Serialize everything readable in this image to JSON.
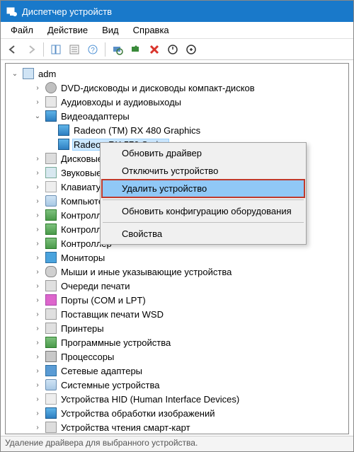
{
  "title": "Диспетчер устройств",
  "menu": {
    "file": "Файл",
    "action": "Действие",
    "view": "Вид",
    "help": "Справка"
  },
  "tree": {
    "root": "adm",
    "items": [
      {
        "label": "DVD-дисководы и дисководы компакт-дисков",
        "indent": 2,
        "icon": "icn-disc",
        "exp": ">"
      },
      {
        "label": "Аудиовходы и аудиовыходы",
        "indent": 2,
        "icon": "icn-audio",
        "exp": ">"
      },
      {
        "label": "Видеоадаптеры",
        "indent": 2,
        "icon": "icn-vid",
        "exp": "v"
      },
      {
        "label": "Radeon (TM) RX 480 Graphics",
        "indent": 3,
        "icon": "icn-vid",
        "exp": ""
      },
      {
        "label": "Radeon RX 570 Series",
        "indent": 3,
        "icon": "icn-vid",
        "exp": "",
        "sel": true
      },
      {
        "label": "Дисковые у",
        "indent": 2,
        "icon": "icn-drv",
        "exp": ">"
      },
      {
        "label": "Звуковые, в",
        "indent": 2,
        "icon": "icn-snd",
        "exp": ">"
      },
      {
        "label": "Клавиатуры",
        "indent": 2,
        "icon": "icn-kb",
        "exp": ">"
      },
      {
        "label": "Компьютер",
        "indent": 2,
        "icon": "icn-pc",
        "exp": ">"
      },
      {
        "label": "Контроллер",
        "indent": 2,
        "icon": "icn-ctr",
        "exp": ">"
      },
      {
        "label": "Контроллер",
        "indent": 2,
        "icon": "icn-ctr",
        "exp": ">"
      },
      {
        "label": "Контроллер",
        "indent": 2,
        "icon": "icn-ctr",
        "exp": ">"
      },
      {
        "label": "Мониторы",
        "indent": 2,
        "icon": "icn-mon",
        "exp": ">"
      },
      {
        "label": "Мыши и иные указывающие устройства",
        "indent": 2,
        "icon": "icn-mouse",
        "exp": ">"
      },
      {
        "label": "Очереди печати",
        "indent": 2,
        "icon": "icn-prn",
        "exp": ">"
      },
      {
        "label": "Порты (COM и LPT)",
        "indent": 2,
        "icon": "icn-port",
        "exp": ">"
      },
      {
        "label": "Поставщик печати WSD",
        "indent": 2,
        "icon": "icn-prn",
        "exp": ">"
      },
      {
        "label": "Принтеры",
        "indent": 2,
        "icon": "icn-prn",
        "exp": ">"
      },
      {
        "label": "Программные устройства",
        "indent": 2,
        "icon": "icn-ctr",
        "exp": ">"
      },
      {
        "label": "Процессоры",
        "indent": 2,
        "icon": "icn-cpu",
        "exp": ">"
      },
      {
        "label": "Сетевые адаптеры",
        "indent": 2,
        "icon": "icn-net",
        "exp": ">"
      },
      {
        "label": "Системные устройства",
        "indent": 2,
        "icon": "icn-pc",
        "exp": ">"
      },
      {
        "label": "Устройства HID (Human Interface Devices)",
        "indent": 2,
        "icon": "icn-kb",
        "exp": ">"
      },
      {
        "label": "Устройства обработки изображений",
        "indent": 2,
        "icon": "icn-vid",
        "exp": ">"
      },
      {
        "label": "Устройства чтения смарт-карт",
        "indent": 2,
        "icon": "icn-drv",
        "exp": ">"
      }
    ]
  },
  "context": {
    "update": "Обновить драйвер",
    "disable": "Отключить устройство",
    "uninstall": "Удалить устройство",
    "scan": "Обновить конфигурацию оборудования",
    "props": "Свойства"
  },
  "status": "Удаление драйвера для выбранного устройства."
}
